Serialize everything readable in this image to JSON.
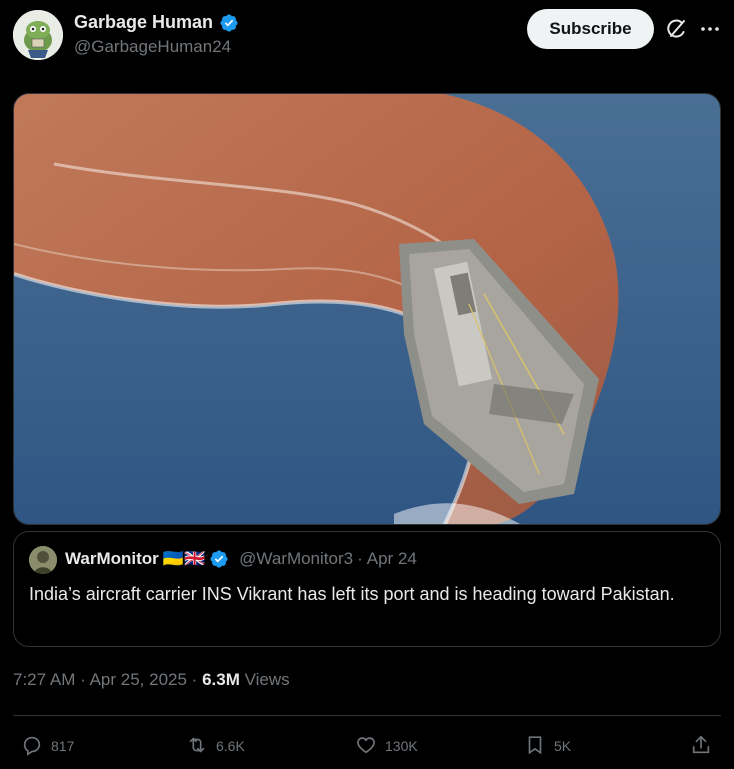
{
  "author": {
    "display_name": "Garbage Human",
    "handle": "@GarbageHuman24"
  },
  "header": {
    "subscribe_label": "Subscribe"
  },
  "quoted": {
    "display_name": "WarMonitor",
    "flags": "🇺🇦🇬🇧",
    "handle": "@WarMonitor3",
    "separator": "·",
    "date": "Apr 24",
    "text": "India’s aircraft carrier INS Vikrant has left its port and is heading toward Pakistan."
  },
  "meta": {
    "time": "7:27 AM",
    "separator": "·",
    "date": "Apr 25, 2025",
    "views_count": "6.3M",
    "views_label": "Views"
  },
  "actions": {
    "replies": "817",
    "reposts": "6.6K",
    "likes": "130K",
    "bookmarks": "5K"
  },
  "icons": [
    "verified-badge-icon",
    "grok-icon",
    "more-icon",
    "reply-icon",
    "repost-icon",
    "like-icon",
    "bookmark-icon",
    "share-icon"
  ],
  "colors": {
    "background": "#000000",
    "verified": "#1d9bf0",
    "muted_text": "#71767b",
    "primary_text": "#e7e9ea"
  }
}
